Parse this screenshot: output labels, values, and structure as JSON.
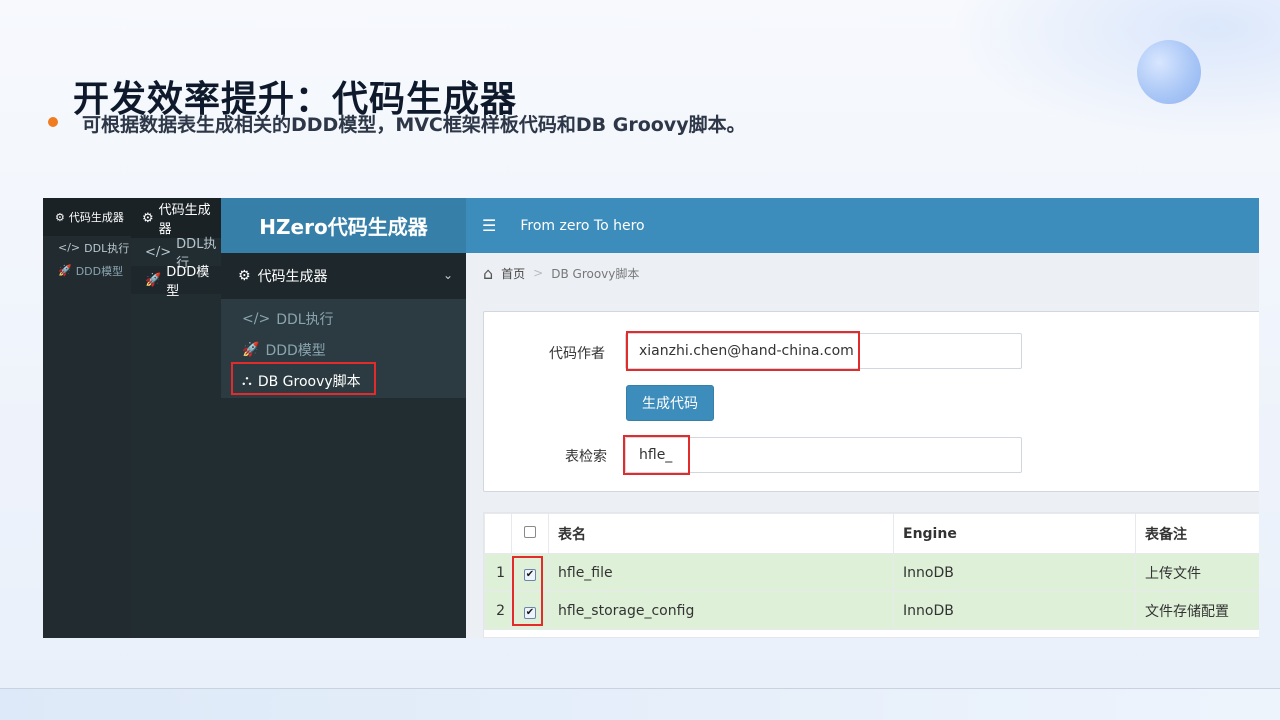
{
  "slide": {
    "title": "开发效率提升：代码生成器",
    "subtitle": "可根据数据表生成相关的DDD模型，MVC框架样板代码和DB Groovy脚本。"
  },
  "sidebar_small": {
    "header": "代码生成器",
    "items": [
      {
        "label": "DDL执行",
        "icon": "code-icon"
      },
      {
        "label": "DDD模型",
        "icon": "rocket-icon"
      }
    ]
  },
  "sidebar_medium": {
    "header": "代码生成器",
    "items": [
      {
        "label": "DDL执行",
        "icon": "code-icon"
      },
      {
        "label": "DDD模型",
        "icon": "rocket-icon"
      }
    ]
  },
  "sidebar_main": {
    "logo": "HZero代码生成器",
    "menu_header": "代码生成器",
    "items": [
      {
        "label": "DDL执行",
        "icon": "code-icon"
      },
      {
        "label": "DDD模型",
        "icon": "rocket-icon"
      },
      {
        "label": "DB Groovy脚本",
        "icon": "cubes-icon"
      }
    ]
  },
  "topbar": {
    "tagline": "From zero To hero"
  },
  "breadcrumb": {
    "home": "首页",
    "separator": ">",
    "current": "DB Groovy脚本"
  },
  "form": {
    "author_label": "代码作者",
    "author_value": "xianzhi.chen@hand-china.com",
    "generate_button": "生成代码",
    "search_label": "表检索",
    "search_value": "hfle_"
  },
  "table": {
    "headers": [
      "表名",
      "Engine",
      "表备注"
    ],
    "rows": [
      {
        "index": "1",
        "checked": true,
        "name": "hfle_file",
        "engine": "InnoDB",
        "comment": "上传文件"
      },
      {
        "index": "2",
        "checked": true,
        "name": "hfle_storage_config",
        "engine": "InnoDB",
        "comment": "文件存储配置"
      }
    ]
  },
  "colors": {
    "accent": "#3c8dbc",
    "sidebar": "#222d32",
    "highlight": "#e22b2b",
    "row_selected": "#dff0d8",
    "bullet": "#f07c21"
  }
}
